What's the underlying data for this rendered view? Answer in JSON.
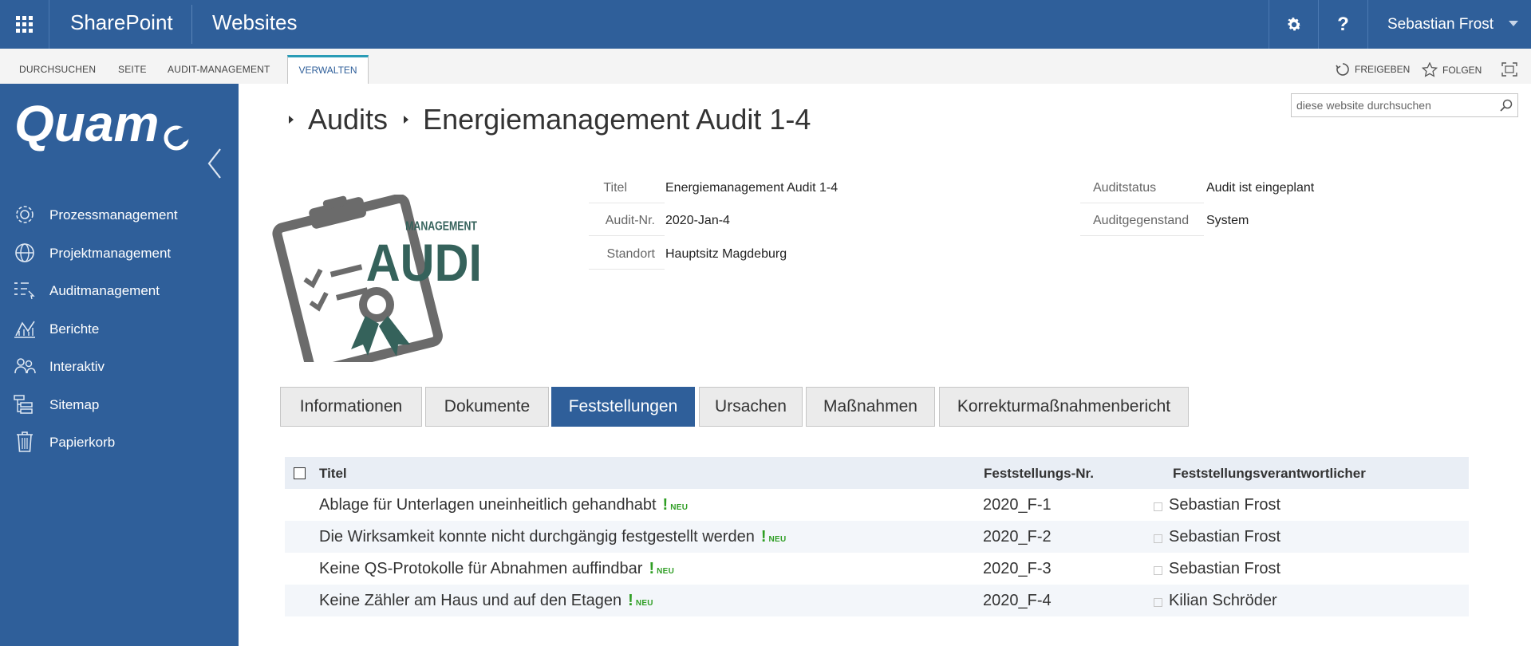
{
  "suitebar": {
    "brand": "SharePoint",
    "site_link": "Websites",
    "help_label": "?",
    "user_name": "Sebastian Frost"
  },
  "ribbon": {
    "tabs": [
      "DURCHSUCHEN",
      "SEITE",
      "AUDIT-MANAGEMENT",
      "VERWALTEN"
    ],
    "active_tab": "VERWALTEN",
    "share_label": "FREIGEBEN",
    "follow_label": "FOLGEN"
  },
  "sidebar": {
    "logo_text": "Quam",
    "items": [
      {
        "label": "Prozessmanagement",
        "icon": "gear-process-icon"
      },
      {
        "label": "Projektmanagement",
        "icon": "globe-icon"
      },
      {
        "label": "Auditmanagement",
        "icon": "checklist-icon"
      },
      {
        "label": "Berichte",
        "icon": "chart-icon"
      },
      {
        "label": "Interaktiv",
        "icon": "people-icon"
      },
      {
        "label": "Sitemap",
        "icon": "sitemap-icon"
      },
      {
        "label": "Papierkorb",
        "icon": "trash-icon"
      }
    ]
  },
  "search": {
    "placeholder": "diese website durchsuchen"
  },
  "breadcrumb": {
    "parent": "Audits",
    "current": "Energiemanagement Audit 1-4"
  },
  "audit_image": {
    "line1": "MANAGEMENT",
    "line2": "AUDIT"
  },
  "metadata": {
    "left": [
      {
        "label": "Titel",
        "value": "Energiemanagement Audit 1-4"
      },
      {
        "label": "Audit-Nr.",
        "value": "2020-Jan-4"
      },
      {
        "label": "Standort",
        "value": "Hauptsitz Magdeburg"
      }
    ],
    "right": [
      {
        "label": "Auditstatus",
        "value": "Audit ist eingeplant"
      },
      {
        "label": "Auditgegenstand",
        "value": "System"
      }
    ]
  },
  "tabs": [
    {
      "label": "Informationen",
      "active": false
    },
    {
      "label": "Dokumente",
      "active": false
    },
    {
      "label": "Feststellungen",
      "active": true
    },
    {
      "label": "Ursachen",
      "active": false
    },
    {
      "label": "Maßnahmen",
      "active": false
    },
    {
      "label": "Korrekturmaßnahmenbericht",
      "active": false
    }
  ],
  "table": {
    "columns": [
      "Titel",
      "Feststellungs-Nr.",
      "Feststellungsverantwortlicher"
    ],
    "new_mark": "!",
    "new_label": "NEU",
    "rows": [
      {
        "title": "Ablage für Unterlagen uneinheitlich gehandhabt",
        "nr": "2020_F-1",
        "person": "Sebastian Frost"
      },
      {
        "title": "Die Wirksamkeit konnte nicht durchgängig festgestellt werden",
        "nr": "2020_F-2",
        "person": "Sebastian Frost"
      },
      {
        "title": "Keine QS-Protokolle für Abnahmen auffindbar",
        "nr": "2020_F-3",
        "person": "Sebastian Frost"
      },
      {
        "title": "Keine Zähler am Haus und auf den Etagen",
        "nr": "2020_F-4",
        "person": "Kilian Schröder"
      }
    ]
  },
  "colors": {
    "brand_blue": "#2f5f9a",
    "ribbon_active": "#2a9cb6",
    "new_green": "#2f9e24",
    "audit_grey": "#6b6b6b",
    "audit_teal": "#35625b"
  }
}
